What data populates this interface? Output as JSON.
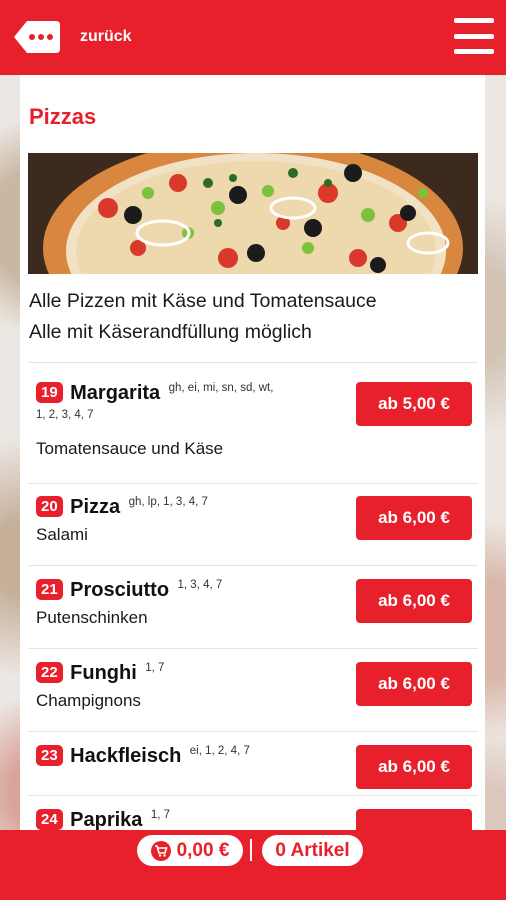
{
  "header": {
    "back_label": "zurück",
    "menu_icon": "hamburger-icon",
    "back_icon": "chat-bubble-back-icon",
    "accent": "#e8202b"
  },
  "section": {
    "title": "Pizzas",
    "intro_line1": "Alle Pizzen mit Käse und Tomatensauce",
    "intro_line2": "Alle mit Käserandfüllung möglich"
  },
  "items": [
    {
      "number": "19",
      "name": "Margarita",
      "codes": "gh, ei, mi, sn, sd, wt,",
      "codes_line2": "1, 2, 3, 4, 7",
      "description": "Tomatensauce und Käse",
      "price": "ab 5,00 €"
    },
    {
      "number": "20",
      "name": "Pizza",
      "codes": "gh, lp, 1, 3, 4, 7",
      "description": "Salami",
      "price": "ab 6,00 €"
    },
    {
      "number": "21",
      "name": "Prosciutto",
      "codes": "1, 3, 4, 7",
      "description": "Putenschinken",
      "price": "ab 6,00 €"
    },
    {
      "number": "22",
      "name": "Funghi",
      "codes": "1, 7",
      "description": "Champignons",
      "price": "ab 6,00 €"
    },
    {
      "number": "23",
      "name": "Hackfleisch",
      "codes": "ei, 1, 2, 4, 7",
      "description": "",
      "price": "ab 6,00 €"
    },
    {
      "number": "24",
      "name": "Paprika",
      "codes": "1, 7",
      "description": "",
      "price": ""
    }
  ],
  "footer": {
    "cart_total": "0,00 €",
    "cart_icon": "shopping-cart-icon",
    "item_count": "0 Artikel"
  }
}
